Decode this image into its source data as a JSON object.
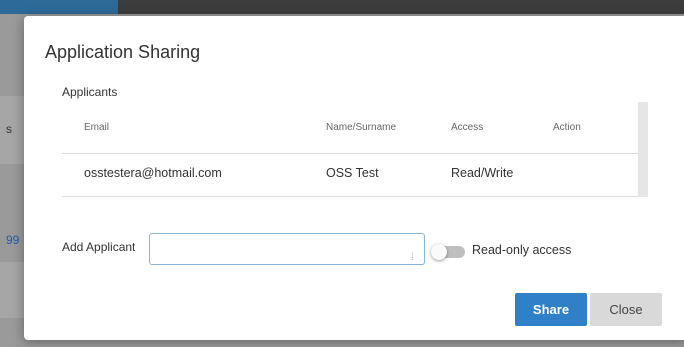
{
  "background": {
    "side_text_1": "s",
    "side_text_2": "99"
  },
  "modal": {
    "title": "Application Sharing",
    "applicants_label": "Applicants",
    "table": {
      "columns": [
        "Email",
        "Name/Surname",
        "Access",
        "Action"
      ],
      "rows": [
        {
          "email": "osstestera@hotmail.com",
          "name": "OSS Test",
          "access": "Read/Write",
          "action": ""
        }
      ]
    },
    "add_applicant": {
      "label": "Add Applicant",
      "value": "",
      "placeholder": ""
    },
    "readonly_toggle": {
      "label": "Read-only access",
      "on": false
    },
    "buttons": {
      "share": "Share",
      "close": "Close"
    }
  },
  "colors": {
    "accent": "#2f80c7",
    "overlay": "#8d8d8d",
    "toggle_off": "#bfbfbf"
  },
  "icons": {
    "toggle": "toggle-switch-off"
  }
}
